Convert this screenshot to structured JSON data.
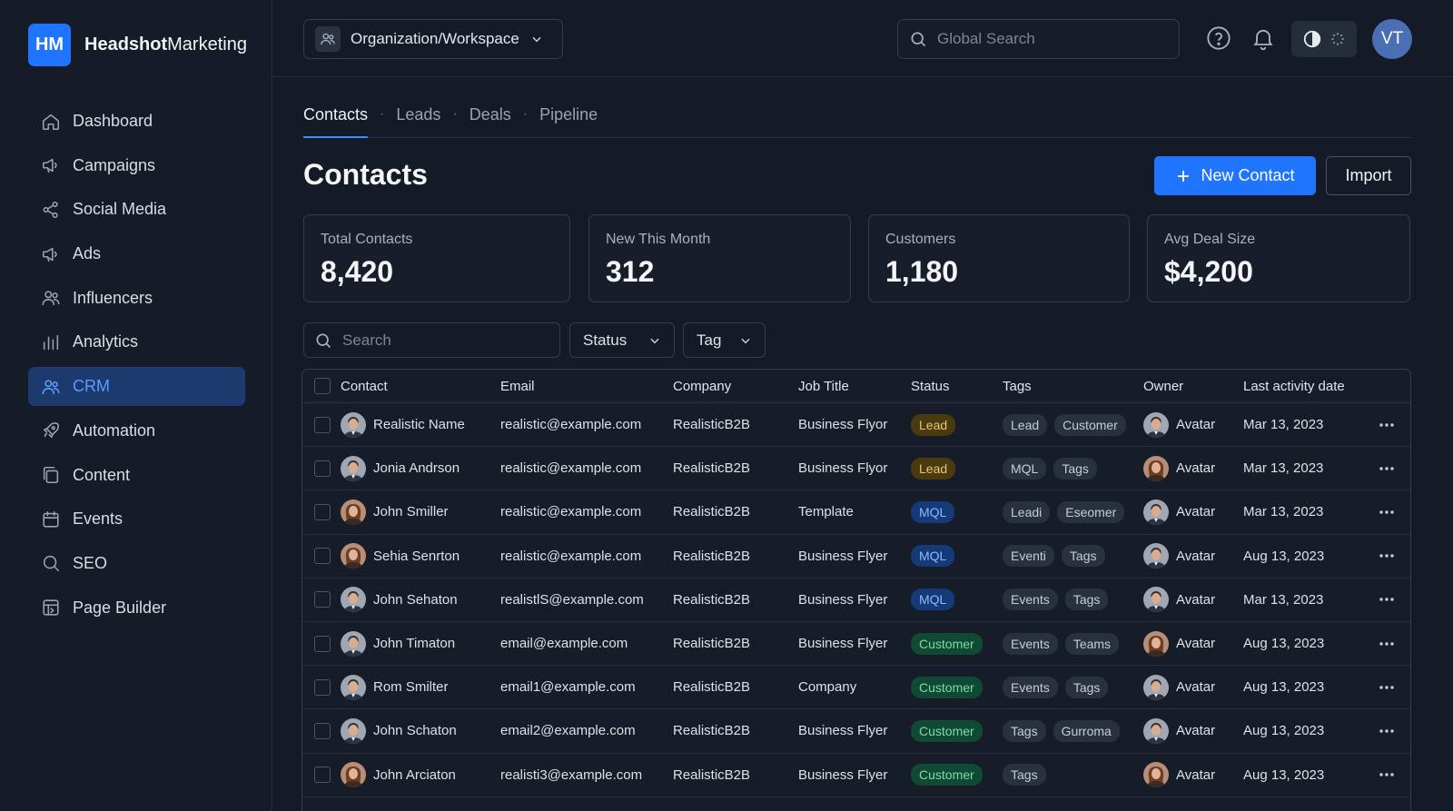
{
  "app": {
    "logo_initials": "HM",
    "brand_bold": "Headshot",
    "brand_rest": "Marketing",
    "accent_color": "#1f75ff"
  },
  "sidebar": {
    "items": [
      {
        "label": "Dashboard",
        "icon": "home-icon"
      },
      {
        "label": "Campaigns",
        "icon": "megaphone-icon"
      },
      {
        "label": "Social Media",
        "icon": "share-icon"
      },
      {
        "label": "Ads",
        "icon": "megaphone-icon"
      },
      {
        "label": "Influencers",
        "icon": "users-icon"
      },
      {
        "label": "Analytics",
        "icon": "bar-chart-icon"
      },
      {
        "label": "CRM",
        "icon": "users-icon",
        "active": true
      },
      {
        "label": "Automation",
        "icon": "rocket-icon"
      },
      {
        "label": "Content",
        "icon": "copy-icon"
      },
      {
        "label": "Events",
        "icon": "calendar-icon"
      },
      {
        "label": "SEO",
        "icon": "search-icon"
      },
      {
        "label": "Page Builder",
        "icon": "layout-icon"
      }
    ]
  },
  "header": {
    "workspace_label": "Organization/Workspace",
    "search_placeholder": "Global Search",
    "user_initials": "VT"
  },
  "tabs": [
    {
      "label": "Contacts",
      "active": true
    },
    {
      "label": "Leads"
    },
    {
      "label": "Deals"
    },
    {
      "label": "Pipeline"
    }
  ],
  "tab_separator": "·",
  "page": {
    "title": "Contacts",
    "new_button": "New Contact",
    "import_button": "Import"
  },
  "stats": [
    {
      "label": "Total Contacts",
      "value": "8,420"
    },
    {
      "label": "New This Month",
      "value": "312"
    },
    {
      "label": "Customers",
      "value": "1,180"
    },
    {
      "label": "Avg Deal Size",
      "value": "$4,200"
    }
  ],
  "filters": {
    "search_placeholder": "Search",
    "status_label": "Status",
    "tag_label": "Tag"
  },
  "table": {
    "columns": [
      "Contact",
      "Email",
      "Company",
      "Job Title",
      "Status",
      "Tags",
      "Owner",
      "Last activity date"
    ],
    "rows": [
      {
        "name": "Realistic Name",
        "avatar": "male",
        "email": "realistic@example.com",
        "company": "RealisticB2B",
        "job": "Business Flyor",
        "status": "Lead",
        "status_kind": "lead",
        "tags": [
          "Lead",
          "Customer"
        ],
        "owner": "Avatar",
        "owner_avatar": "male",
        "date": "Mar 13, 2023"
      },
      {
        "name": "Jonia Andrson",
        "avatar": "male",
        "email": "realistic@example.com",
        "company": "RealisticB2B",
        "job": "Business Flyor",
        "status": "Lead",
        "status_kind": "lead",
        "tags": [
          "MQL",
          "Tags"
        ],
        "owner": "Avatar",
        "owner_avatar": "female",
        "date": "Mar 13, 2023"
      },
      {
        "name": "John Smiller",
        "avatar": "female",
        "email": "realistic@example.com",
        "company": "RealisticB2B",
        "job": "Template",
        "status": "MQL",
        "status_kind": "mql",
        "tags": [
          "Leadi",
          "Eseomer"
        ],
        "owner": "Avatar",
        "owner_avatar": "male",
        "date": "Mar 13, 2023"
      },
      {
        "name": "Sehia Senrton",
        "avatar": "female",
        "email": "realistic@example.com",
        "company": "RealisticB2B",
        "job": "Business Flyer",
        "status": "MQL",
        "status_kind": "mql",
        "tags": [
          "Eventi",
          "Tags"
        ],
        "owner": "Avatar",
        "owner_avatar": "male",
        "date": "Aug 13, 2023"
      },
      {
        "name": "John Sehaton",
        "avatar": "male",
        "email": "realistlS@example.com",
        "company": "RealisticB2B",
        "job": "Business Flyer",
        "status": "MQL",
        "status_kind": "mql",
        "tags": [
          "Events",
          "Tags"
        ],
        "owner": "Avatar",
        "owner_avatar": "male",
        "date": "Mar 13, 2023"
      },
      {
        "name": "John Timaton",
        "avatar": "male",
        "email": "email@example.com",
        "company": "RealisticB2B",
        "job": "Business Flyer",
        "status": "Customer",
        "status_kind": "customer",
        "tags": [
          "Events",
          "Teams"
        ],
        "owner": "Avatar",
        "owner_avatar": "female",
        "date": "Aug 13, 2023"
      },
      {
        "name": "Rom Smilter",
        "avatar": "male",
        "email": "email1@example.com",
        "company": "RealisticB2B",
        "job": "Company",
        "status": "Customer",
        "status_kind": "customer",
        "tags": [
          "Events",
          "Tags"
        ],
        "owner": "Avatar",
        "owner_avatar": "male",
        "date": "Aug 13, 2023"
      },
      {
        "name": "John Schaton",
        "avatar": "male",
        "email": "email2@example.com",
        "company": "RealisticB2B",
        "job": "Business Flyer",
        "status": "Customer",
        "status_kind": "customer",
        "tags": [
          "Tags",
          "Gurroma"
        ],
        "owner": "Avatar",
        "owner_avatar": "male",
        "date": "Aug 13, 2023"
      },
      {
        "name": "John Arciaton",
        "avatar": "female",
        "email": "realisti3@example.com",
        "company": "RealisticB2B",
        "job": "Business Flyer",
        "status": "Customer",
        "status_kind": "customer",
        "tags": [
          "Tags"
        ],
        "owner": "Avatar",
        "owner_avatar": "female",
        "date": "Aug 13, 2023"
      }
    ]
  }
}
